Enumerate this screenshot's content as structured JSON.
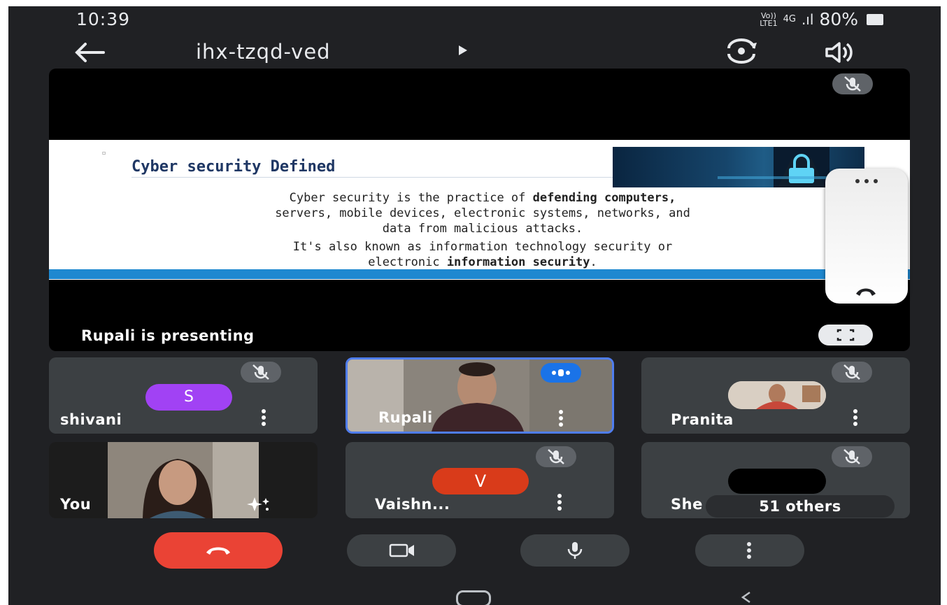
{
  "status": {
    "time": "10:39",
    "network_top": "Vo))",
    "network_bottom": "LTE1",
    "signal_type": "4G",
    "battery_percent": "80%"
  },
  "header": {
    "meeting_code": "ihx-tzqd-ved"
  },
  "presentation": {
    "presenter_label": "Rupali is presenting",
    "slide": {
      "title": "Cyber security Defined",
      "body_1_plain": "Cyber security is the practice of ",
      "body_1_bold": "defending computers,",
      "body_2": "servers, mobile devices, electronic systems, networks, and",
      "body_3": "data from malicious attacks.",
      "body_4": "It's also known as information technology security or",
      "body_5_plain": "electronic ",
      "body_5_bold": "information security",
      "body_5_end": "."
    }
  },
  "participants": [
    {
      "name": "shivani",
      "initial": "S",
      "avatar_color": "#a142f4",
      "muted": true
    },
    {
      "name": "Rupali",
      "speaking": true
    },
    {
      "name": "Pranita",
      "muted": true
    },
    {
      "name": "You"
    },
    {
      "name": "Vaishn...",
      "initial": "V",
      "avatar_color": "#d93b1a",
      "muted": true
    },
    {
      "name": "She",
      "others_label": "51 others",
      "muted": true
    }
  ],
  "colors": {
    "end_call": "#ea4335",
    "speaking": "#1a73e8",
    "background": "#202124",
    "tile": "#3c4043"
  },
  "icons": [
    "arrow-left-icon",
    "play-arrow-icon",
    "switch-camera-icon",
    "speaker-icon",
    "mic-off-icon",
    "fullscreen-icon",
    "more-vert-icon",
    "phone-icon",
    "end-call-icon",
    "video-icon",
    "mic-icon",
    "sparkle-effects-icon"
  ]
}
